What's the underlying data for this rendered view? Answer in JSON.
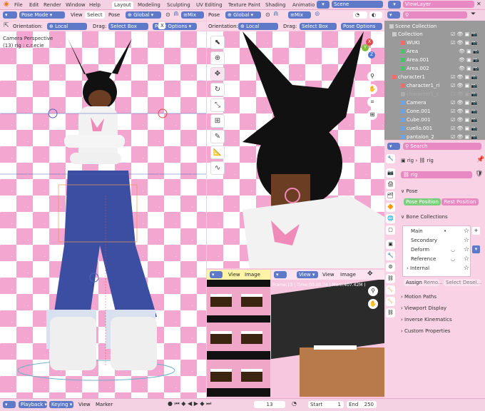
{
  "menu": [
    "File",
    "Edit",
    "Render",
    "Window",
    "Help"
  ],
  "workspaces": [
    "Layout",
    "Modeling",
    "Sculpting",
    "UV Editing",
    "Texture Paint",
    "Shading",
    "Animatio"
  ],
  "active_workspace": "Layout",
  "scene": {
    "name": "Scene"
  },
  "view_layer": {
    "name": "ViewLayer"
  },
  "left_view": {
    "mode": "Pose Mode",
    "menus": [
      "View",
      "Select",
      "Pose"
    ],
    "orientation_chip": "Global",
    "mix": "Mix",
    "orientation_label": "Orientation:",
    "orientation_value": "Local",
    "drag_label": "Drag:",
    "drag_value": "Select Box",
    "pose_options": "Pose Options",
    "overlay_title": "Camera Perspective",
    "overlay_sub": "(13) rig : c.r.ecie"
  },
  "right_view": {
    "mode_label": "Pose",
    "orientation_chip": "Global",
    "mix": "Mix",
    "orientation_label": "Orientation:",
    "orientation_value": "Local",
    "drag_label": "Drag:",
    "drag_value": "Select Box",
    "pose_options": "Pose Options",
    "x_btn": "X",
    "gizmo": {
      "x": "X",
      "y": "Y",
      "z": "Z"
    }
  },
  "image_editors": [
    {
      "menus": [
        "View",
        "Image"
      ]
    },
    {
      "view_btn": "View",
      "menus": [
        "View",
        "Image"
      ],
      "status": "Frame:13 | Time:00:00.74 | Mem:407.42M (Pea"
    }
  ],
  "outliner": {
    "root": "Scene Collection",
    "rows": [
      {
        "name": "Collection",
        "level": 1,
        "dim": false
      },
      {
        "name": "WUKI",
        "level": 2,
        "dim": false
      },
      {
        "name": "Area",
        "level": 2,
        "dim": false
      },
      {
        "name": "Area.001",
        "level": 2,
        "dim": false
      },
      {
        "name": "Area.002",
        "level": 2,
        "dim": false
      },
      {
        "name": "character1",
        "level": 1,
        "dim": false
      },
      {
        "name": "character1_ri",
        "level": 2,
        "dim": false
      },
      {
        "name": "character1_c",
        "level": 2,
        "dim": true
      },
      {
        "name": "Camera",
        "level": 2,
        "dim": false
      },
      {
        "name": "Cone.001",
        "level": 2,
        "dim": false
      },
      {
        "name": "Cube.001",
        "level": 2,
        "dim": false
      },
      {
        "name": "cuello.001",
        "level": 2,
        "dim": false
      },
      {
        "name": "pantalon_2",
        "level": 2,
        "dim": false
      }
    ]
  },
  "properties": {
    "search_placeholder": "Search",
    "breadcrumb": [
      "rig",
      "rig"
    ],
    "name_field": "rig",
    "pose_section": "Pose",
    "pose_position": "Pose Position",
    "rest_position": "Rest Position",
    "bone_collections_title": "Bone Collections",
    "bone_collections": [
      "Main",
      "Secondary",
      "Deform",
      "Reference",
      "Internal"
    ],
    "assign": "Assign",
    "remove": "Remo...",
    "select": "Select",
    "deselect": "Desel...",
    "sections": [
      "Motion Paths",
      "Viewport Display",
      "Inverse Kinematics",
      "Custom Properties"
    ]
  },
  "timeline": {
    "playback": "Playback",
    "keying": "Keying",
    "view": "View",
    "marker": "Marker",
    "current_frame": "13",
    "start_label": "Start",
    "start": "1",
    "end_label": "End",
    "end": "250"
  }
}
